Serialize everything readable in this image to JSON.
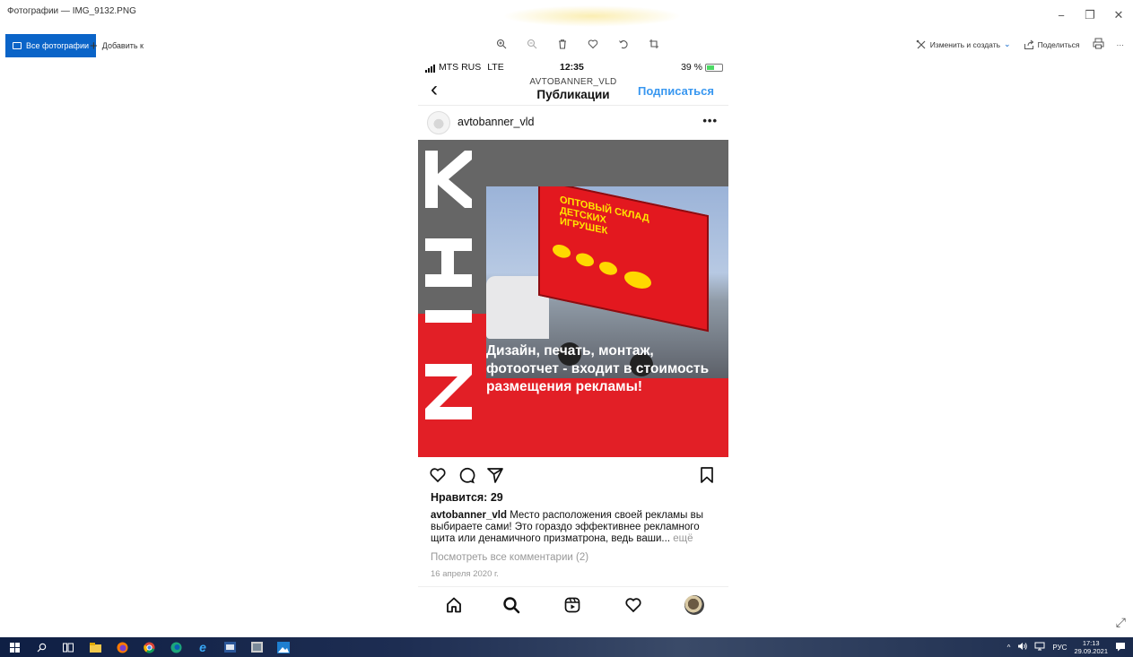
{
  "window": {
    "title": "Фотографии — IMG_9132.PNG",
    "controls": {
      "minimize": "−",
      "restore": "❐",
      "close": "✕"
    }
  },
  "toolbar": {
    "all_photos": "Все фотографии",
    "add_to": "Добавить к",
    "edit_create": "Изменить и создать",
    "share": "Поделиться",
    "more": "···"
  },
  "phone": {
    "status": {
      "carrier": "MTS RUS",
      "network": "LTE",
      "time": "12:35",
      "battery": "39 %"
    },
    "header": {
      "account": "AVTOBANNER_VLD",
      "title": "Публикации",
      "subscribe": "Подписаться"
    },
    "post": {
      "username": "avtobanner_vld",
      "image_text": "Дизайн, печать, монтаж, фотоотчет - входит в стоимость размещения рекламы!",
      "truck_sign": "ОПТОВЫЙ СКЛАД ДЕТСКИХ ИГРУШЕК",
      "likes": "Нравится: 29",
      "caption_user": "avtobanner_vld",
      "caption": " Место расположения своей рекламы вы выбираете сами! Это гораздо эффективнее рекламного щита или денамичного призматрона, ведь ваши...",
      "caption_more": " ещё",
      "view_comments": "Посмотреть все комментарии (2)",
      "date": "16 апреля 2020 г."
    }
  },
  "taskbar": {
    "lang": "РУС",
    "time": "17:13",
    "date": "29.09.2021"
  },
  "colors": {
    "accent": "#0a64c8",
    "instagram_blue": "#3897f0",
    "brand_red": "#e21f26"
  }
}
